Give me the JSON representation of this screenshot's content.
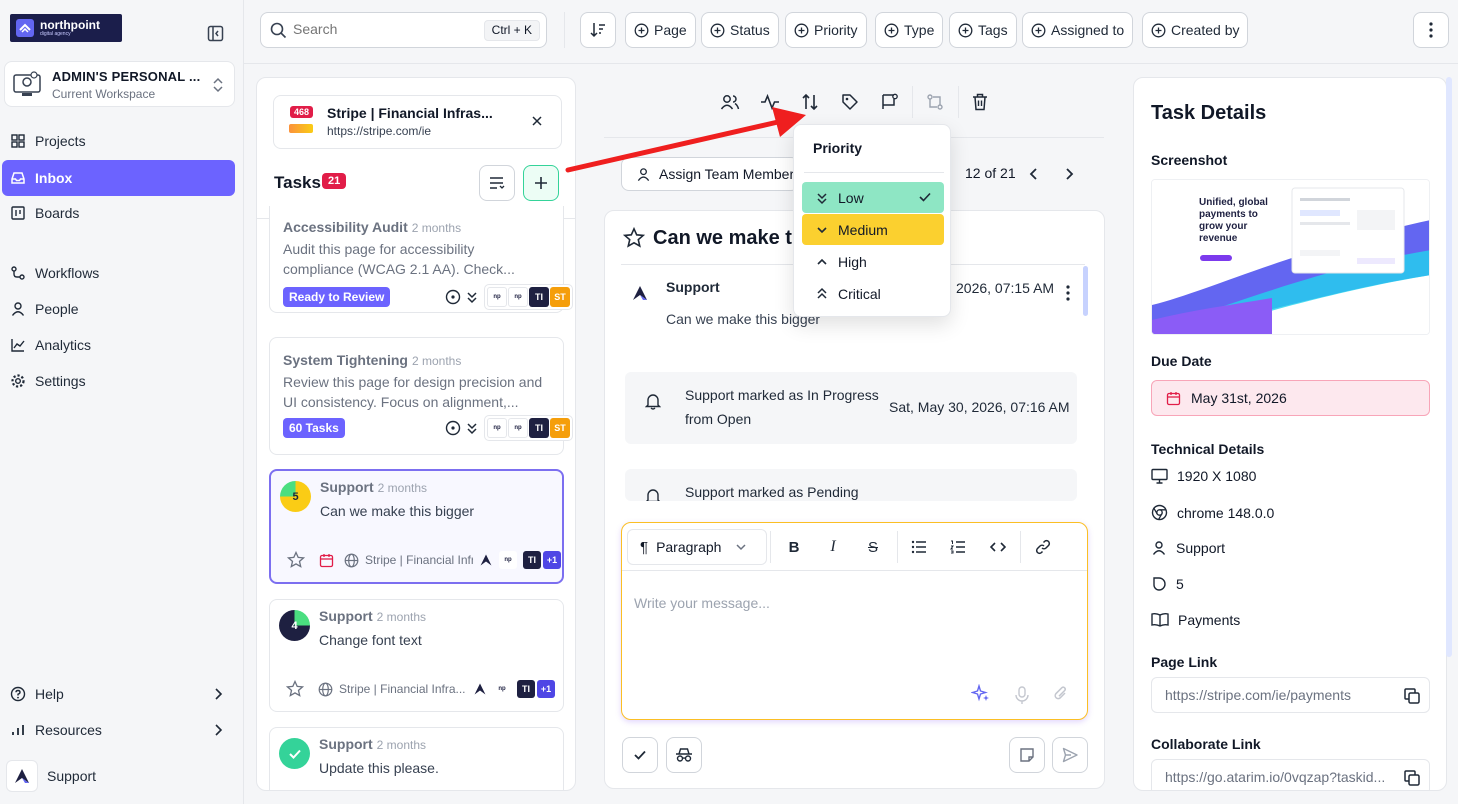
{
  "brand": {
    "name": "northpoint",
    "tagline": "digital agency"
  },
  "workspace": {
    "title": "ADMIN'S PERSONAL ...",
    "subtitle": "Current Workspace"
  },
  "nav": {
    "projects": "Projects",
    "inbox": "Inbox",
    "boards": "Boards",
    "workflows": "Workflows",
    "people": "People",
    "analytics": "Analytics",
    "settings": "Settings",
    "help": "Help",
    "resources": "Resources",
    "user": "Support"
  },
  "topbar": {
    "search_placeholder": "Search",
    "shortcut": "Ctrl + K",
    "filters": [
      "Page",
      "Status",
      "Priority",
      "Type",
      "Tags",
      "Assigned to",
      "Created by"
    ]
  },
  "site": {
    "badge": "468",
    "title": "Stripe | Financial Infras...",
    "url": "https://stripe.com/ie"
  },
  "tasks": {
    "heading": "Tasks",
    "count": "21",
    "items": [
      {
        "title": "Accessibility Audit",
        "ago": "2 months",
        "desc": "Audit this page for accessibility compliance (WCAG 2.1 AA). Check...",
        "tag": "Ready to Review",
        "av1": "TI",
        "av2": "ST"
      },
      {
        "title": "System Tightening",
        "ago": "2 months",
        "desc": "Review this page for design precision and UI consistency. Focus on alignment,...",
        "tag": "60 Tasks",
        "av1": "TI",
        "av2": "ST"
      },
      {
        "title": "Support",
        "ago": "2 months",
        "desc": "Can we make this bigger",
        "num": "5",
        "site": "Stripe | Financial Infr",
        "av1": "TI",
        "more": "+1"
      },
      {
        "title": "Support",
        "ago": "2 months",
        "desc": "Change font text",
        "num": "4",
        "site": "Stripe | Financial Infra...",
        "av1": "TI",
        "more": "+1"
      },
      {
        "title": "Support",
        "ago": "2 months",
        "desc": "Update this please."
      }
    ]
  },
  "thread": {
    "assign_label": "Assign Team Member",
    "pager": "12 of 21",
    "title": "Can we make th",
    "message": {
      "author": "Support",
      "time": "2026, 07:15 AM",
      "text": "Can we make this bigger"
    },
    "activity": [
      {
        "text1": "Support marked as In Progress",
        "text2": "from Open",
        "time": "Sat, May 30, 2026, 07:16 AM"
      },
      {
        "text1": "Support marked as Pending"
      }
    ],
    "editor": {
      "block_type": "Paragraph",
      "placeholder": "Write your message..."
    }
  },
  "priority_menu": {
    "title": "Priority",
    "options": [
      {
        "label": "Low",
        "color": "#8ee6c4"
      },
      {
        "label": "Medium",
        "color": "#fbd02f"
      },
      {
        "label": "High"
      },
      {
        "label": "Critical"
      }
    ],
    "selected": "Low"
  },
  "details": {
    "heading": "Task Details",
    "screenshot_label": "Screenshot",
    "screenshot_headline": "Unified, global payments to grow your revenue",
    "due_label": "Due Date",
    "due_value": "May 31st, 2026",
    "tech_label": "Technical Details",
    "resolution": "1920 X 1080",
    "browser": "chrome 148.0.0",
    "reporter": "Support",
    "number": "5",
    "category": "Payments",
    "page_link_label": "Page Link",
    "page_link": "https://stripe.com/ie/payments",
    "collab_label": "Collaborate Link",
    "collab_link": "https://go.atarim.io/0vqzap?taskid..."
  },
  "colors": {
    "accent": "#6c63ff",
    "badge_red": "#e11d48",
    "arrow": "#ef1f1f"
  }
}
